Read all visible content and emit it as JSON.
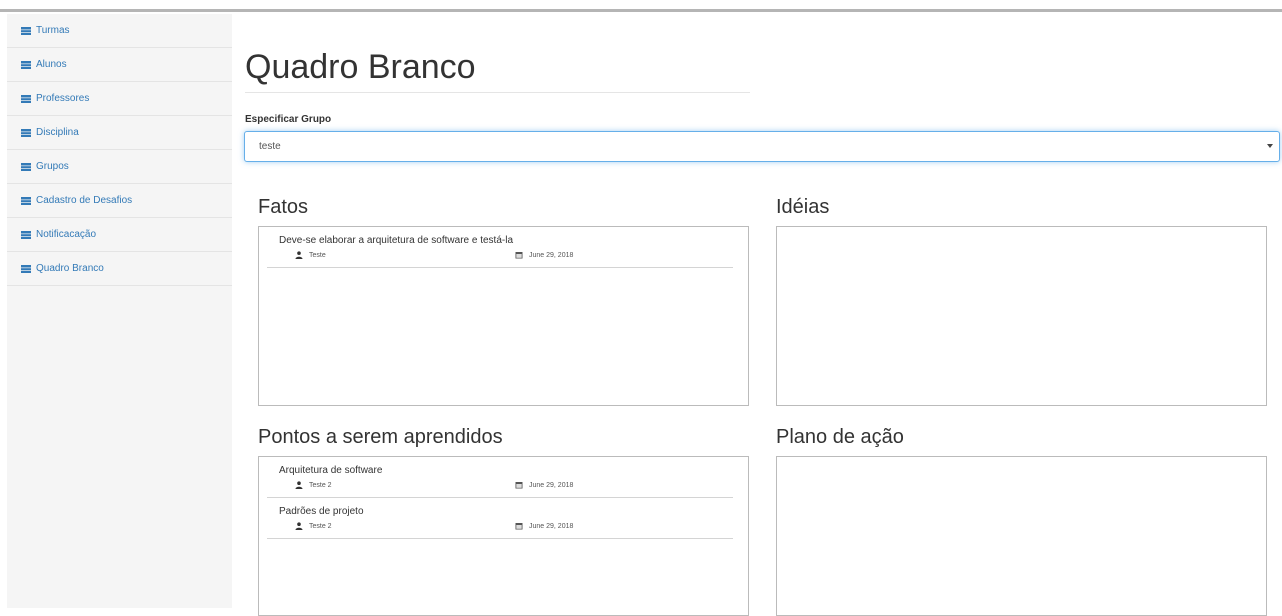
{
  "sidebar": {
    "items": [
      {
        "label": "Turmas"
      },
      {
        "label": "Alunos"
      },
      {
        "label": "Professores"
      },
      {
        "label": "Disciplina"
      },
      {
        "label": "Grupos"
      },
      {
        "label": "Cadastro de Desafios"
      },
      {
        "label": "Notificacação"
      },
      {
        "label": "Quadro Branco"
      }
    ],
    "icon": "table-list-icon",
    "link_color": "#337ab7"
  },
  "page": {
    "title": "Quadro Branco"
  },
  "group": {
    "label": "Especificar Grupo",
    "selected": "teste"
  },
  "sections": {
    "fatos": {
      "title": "Fatos",
      "notes": [
        {
          "text": "Deve-se elaborar a arquitetura de software e testá-la",
          "author": "Teste",
          "date": "June 29, 2018"
        }
      ]
    },
    "ideias": {
      "title": "Idéias",
      "notes": []
    },
    "pontos": {
      "title": "Pontos a serem aprendidos",
      "notes": [
        {
          "text": "Arquitetura de software",
          "author": "Teste 2",
          "date": "June 29, 2018"
        },
        {
          "text": "Padrões de projeto",
          "author": "Teste 2",
          "date": "June 29, 2018"
        }
      ]
    },
    "plano": {
      "title": "Plano de ação",
      "notes": []
    }
  }
}
